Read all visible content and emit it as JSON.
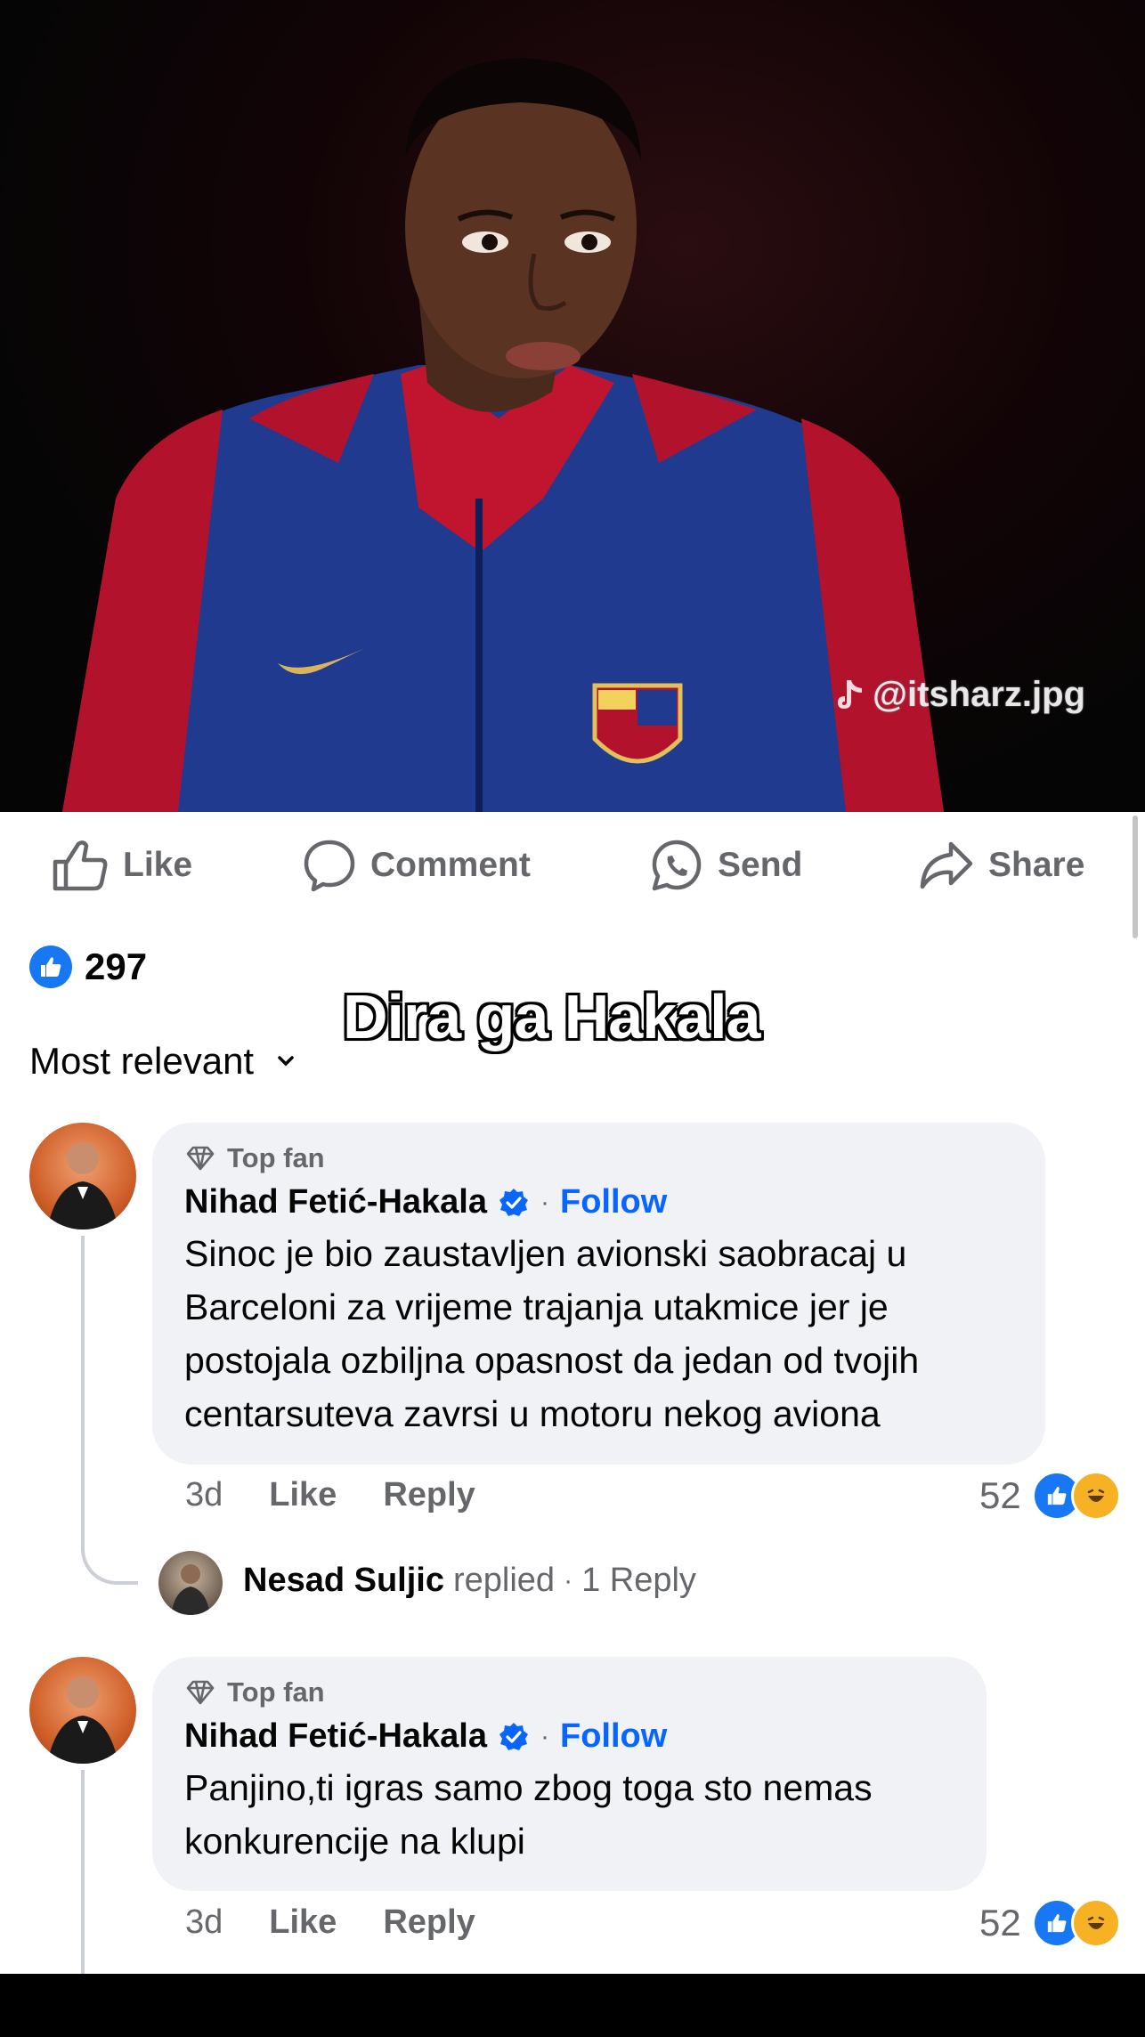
{
  "post": {
    "actions": [
      {
        "label": "Like",
        "icon": "thumbs-up-icon"
      },
      {
        "label": "Comment",
        "icon": "comment-bubble-icon"
      },
      {
        "label": "Send",
        "icon": "whatsapp-icon"
      },
      {
        "label": "Share",
        "icon": "share-arrow-icon"
      }
    ],
    "reaction_count": "297",
    "overlay_caption": "Dira ga Hakala",
    "sort_label": "Most relevant"
  },
  "comments": [
    {
      "badge": "Top fan",
      "author": "Nihad Fetić-Hakala",
      "follow_label": "Follow",
      "text": "Sinoc je bio zaustavljen avionski saobracaj u Barceloni za vrijeme trajanja utakmice jer je postojala ozbiljna opasnost da jedan od tvojih centarsuteva zavrsi u motoru nekog aviona",
      "time": "3d",
      "like_label": "Like",
      "reply_label": "Reply",
      "reaction_count": "52",
      "replies": {
        "name": "Nesad Suljic",
        "action": "replied",
        "count": "1 Reply"
      }
    },
    {
      "badge": "Top fan",
      "author": "Nihad Fetić-Hakala",
      "follow_label": "Follow",
      "text": "Panjino,ti igras samo zbog toga sto nemas konkurencije na klupi",
      "time": "3d",
      "like_label": "Like",
      "reply_label": "Reply",
      "reaction_count": "52"
    }
  ],
  "watermark": "@itsharz.jpg",
  "colors": {
    "facebook_blue": "#1877f2",
    "link_blue": "#0866ff",
    "bubble_gray": "#f0f2f5",
    "muted_text": "#65676b"
  }
}
